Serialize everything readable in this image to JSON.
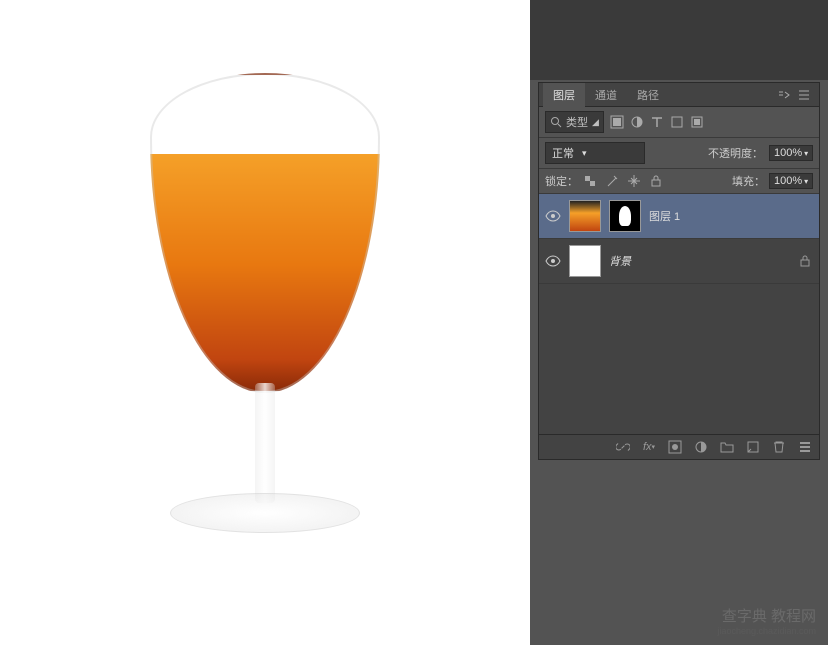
{
  "tabs": {
    "layers": "图层",
    "channels": "通道",
    "paths": "路径"
  },
  "filter": {
    "kind_label": "类型"
  },
  "blend": {
    "mode": "正常",
    "opacity_label": "不透明度：",
    "opacity_value": "100%"
  },
  "lock": {
    "label": "锁定：",
    "fill_label": "填充：",
    "fill_value": "100%"
  },
  "layers": [
    {
      "name": "图层 1",
      "selected": true,
      "hasMask": true,
      "thumb": "juice",
      "locked": false
    },
    {
      "name": "背景",
      "selected": false,
      "hasMask": false,
      "thumb": "white",
      "locked": true
    }
  ],
  "watermark": {
    "main": "查字典 教程网",
    "sub": "jiaocheng.chazidian.com"
  }
}
